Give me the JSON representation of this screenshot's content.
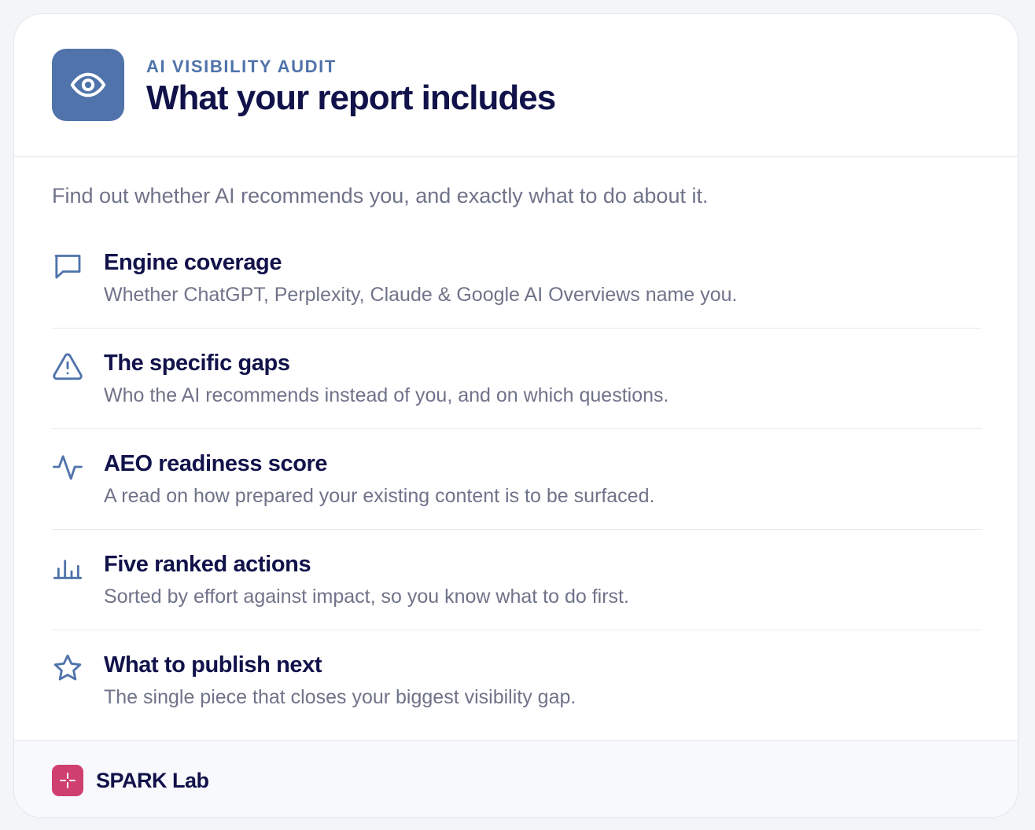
{
  "header": {
    "icon": "eye-icon",
    "eyebrow": "AI VISIBILITY AUDIT",
    "title": "What your report includes"
  },
  "intro": "Find out whether AI recommends you, and exactly what to do about it.",
  "features": [
    {
      "icon": "chat-bubble-icon",
      "title": "Engine coverage",
      "description": "Whether ChatGPT, Perplexity, Claude & Google AI Overviews name you."
    },
    {
      "icon": "warning-triangle-icon",
      "title": "The specific gaps",
      "description": "Who the AI recommends instead of you, and on which questions."
    },
    {
      "icon": "activity-pulse-icon",
      "title": "AEO readiness score",
      "description": "A read on how prepared your existing content is to be surfaced."
    },
    {
      "icon": "bar-chart-icon",
      "title": "Five ranked actions",
      "description": "Sorted by effort against impact, so you know what to do first."
    },
    {
      "icon": "star-icon",
      "title": "What to publish next",
      "description": "The single piece that closes your biggest visibility gap."
    }
  ],
  "footer": {
    "brand_icon": "spark-logo-icon",
    "brand_name": "SPARK Lab"
  },
  "colors": {
    "accent": "#4f73aa",
    "heading": "#11124a",
    "muted_text": "#6f7389",
    "brand": "#cf3f6f",
    "divider": "#e3e5ed"
  }
}
